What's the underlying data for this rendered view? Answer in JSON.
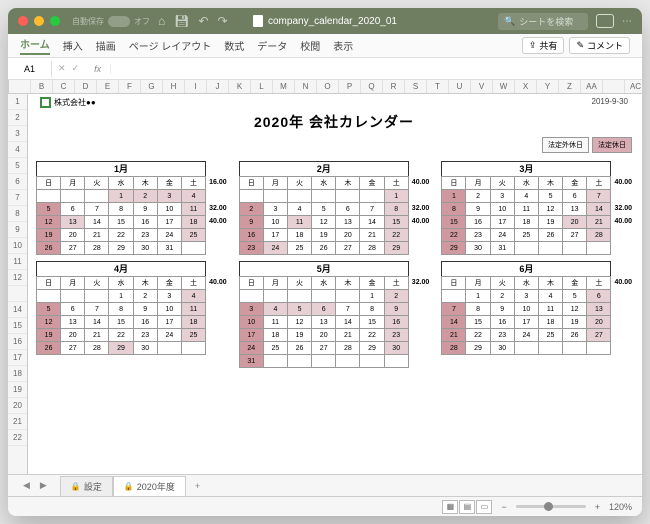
{
  "titlebar": {
    "doc": "company_calendar_2020_01",
    "search": "シートを検索",
    "autosave": "自動保存",
    "off": "オフ"
  },
  "menus": {
    "items": [
      "ホーム",
      "挿入",
      "描画",
      "ページ レイアウト",
      "数式",
      "データ",
      "校閲",
      "表示"
    ],
    "share": "共有",
    "comment": "コメント"
  },
  "fbar": {
    "cell": "A1",
    "fx": "fx"
  },
  "cols": [
    "",
    "B",
    "C",
    "D",
    "E",
    "F",
    "G",
    "H",
    "I",
    "J",
    "K",
    "L",
    "M",
    "N",
    "O",
    "P",
    "Q",
    "R",
    "S",
    "T",
    "U",
    "V",
    "W",
    "X",
    "Y",
    "Z",
    "AA",
    "",
    "AC"
  ],
  "rows": [
    "1",
    "2",
    "3",
    "4",
    "5",
    "6",
    "7",
    "8",
    "9",
    "10",
    "11",
    "12",
    "",
    "14",
    "15",
    "16",
    "17",
    "18",
    "19",
    "20",
    "21",
    "22"
  ],
  "sheet": {
    "company": "株式会社●●",
    "date": "2019-9-30",
    "title": "2020年 会社カレンダー",
    "legend1": "法定外休日",
    "legend2": "法定休日"
  },
  "dow": [
    "日",
    "月",
    "火",
    "水",
    "木",
    "金",
    "土"
  ],
  "months": [
    {
      "title": "1月",
      "side": [
        "16.00",
        "",
        "32.00",
        "40.00"
      ],
      "rows": [
        [
          "",
          "",
          "",
          {
            "t": "1",
            "c": "h1"
          },
          {
            "t": "2",
            "c": "h1"
          },
          {
            "t": "3",
            "c": "h1"
          },
          {
            "t": "4",
            "c": "h1"
          }
        ],
        [
          {
            "t": "5",
            "c": "h2"
          },
          "6",
          "7",
          "8",
          "9",
          "10",
          {
            "t": "11",
            "c": "h1"
          }
        ],
        [
          {
            "t": "12",
            "c": "h2"
          },
          {
            "t": "13",
            "c": "h1"
          },
          "14",
          "15",
          "16",
          "17",
          {
            "t": "18",
            "c": "h1"
          }
        ],
        [
          {
            "t": "19",
            "c": "h2"
          },
          "20",
          "21",
          "22",
          "23",
          "24",
          {
            "t": "25",
            "c": "h1"
          }
        ],
        [
          {
            "t": "26",
            "c": "h2"
          },
          "27",
          "28",
          "29",
          "30",
          "31",
          ""
        ]
      ]
    },
    {
      "title": "2月",
      "side": [
        "40.00",
        "",
        "32.00",
        "40.00"
      ],
      "rows": [
        [
          "",
          "",
          "",
          "",
          "",
          "",
          {
            "t": "1",
            "c": "h1"
          }
        ],
        [
          {
            "t": "2",
            "c": "h2"
          },
          "3",
          "4",
          "5",
          "6",
          "7",
          {
            "t": "8",
            "c": "h1"
          }
        ],
        [
          {
            "t": "9",
            "c": "h2"
          },
          "10",
          {
            "t": "11",
            "c": "h1"
          },
          "12",
          "13",
          "14",
          {
            "t": "15",
            "c": "h1"
          }
        ],
        [
          {
            "t": "16",
            "c": "h2"
          },
          "17",
          "18",
          "19",
          "20",
          "21",
          {
            "t": "22",
            "c": "h1"
          }
        ],
        [
          {
            "t": "23",
            "c": "h2"
          },
          {
            "t": "24",
            "c": "h1"
          },
          "25",
          "26",
          "27",
          "28",
          {
            "t": "29",
            "c": "h1"
          }
        ]
      ]
    },
    {
      "title": "3月",
      "side": [
        "40.00",
        "",
        "32.00",
        "40.00"
      ],
      "rows": [
        [
          {
            "t": "1",
            "c": "h2"
          },
          "2",
          "3",
          "4",
          "5",
          "6",
          {
            "t": "7",
            "c": "h1"
          }
        ],
        [
          {
            "t": "8",
            "c": "h2"
          },
          "9",
          "10",
          "11",
          "12",
          "13",
          {
            "t": "14",
            "c": "h1"
          }
        ],
        [
          {
            "t": "15",
            "c": "h2"
          },
          "16",
          "17",
          "18",
          "19",
          {
            "t": "20",
            "c": "h1"
          },
          {
            "t": "21",
            "c": "h1"
          }
        ],
        [
          {
            "t": "22",
            "c": "h2"
          },
          "23",
          "24",
          "25",
          "26",
          "27",
          {
            "t": "28",
            "c": "h1"
          }
        ],
        [
          {
            "t": "29",
            "c": "h2"
          },
          "30",
          "31",
          "",
          "",
          "",
          ""
        ]
      ]
    },
    {
      "title": "4月",
      "side": [
        "40.00",
        "",
        "",
        "",
        ""
      ],
      "rows": [
        [
          "",
          "",
          "",
          {
            "t": "1"
          },
          "2",
          "3",
          {
            "t": "4",
            "c": "h1"
          }
        ],
        [
          {
            "t": "5",
            "c": "h2"
          },
          "6",
          "7",
          "8",
          "9",
          "10",
          {
            "t": "11",
            "c": "h1"
          }
        ],
        [
          {
            "t": "12",
            "c": "h2"
          },
          "13",
          "14",
          "15",
          "16",
          "17",
          {
            "t": "18",
            "c": "h1"
          }
        ],
        [
          {
            "t": "19",
            "c": "h2"
          },
          "20",
          "21",
          "22",
          "23",
          "24",
          {
            "t": "25",
            "c": "h1"
          }
        ],
        [
          {
            "t": "26",
            "c": "h2"
          },
          "27",
          "28",
          {
            "t": "29",
            "c": "h1"
          },
          "30",
          "",
          ""
        ]
      ]
    },
    {
      "title": "5月",
      "side": [
        "32.00",
        "",
        "",
        "",
        ""
      ],
      "rows": [
        [
          "",
          "",
          "",
          "",
          "",
          {
            "t": "1"
          },
          {
            "t": "2",
            "c": "h1"
          }
        ],
        [
          {
            "t": "3",
            "c": "h2"
          },
          {
            "t": "4",
            "c": "h1"
          },
          {
            "t": "5",
            "c": "h1"
          },
          {
            "t": "6",
            "c": "h1"
          },
          "7",
          "8",
          {
            "t": "9",
            "c": "h1"
          }
        ],
        [
          {
            "t": "10",
            "c": "h2"
          },
          "11",
          "12",
          "13",
          "14",
          "15",
          {
            "t": "16",
            "c": "h1"
          }
        ],
        [
          {
            "t": "17",
            "c": "h2"
          },
          "18",
          "19",
          "20",
          "21",
          "22",
          {
            "t": "23",
            "c": "h1"
          }
        ],
        [
          {
            "t": "24",
            "c": "h2"
          },
          "25",
          "26",
          "27",
          "28",
          "29",
          {
            "t": "30",
            "c": "h1"
          }
        ],
        [
          {
            "t": "31",
            "c": "h2"
          },
          "",
          "",
          "",
          "",
          "",
          ""
        ]
      ]
    },
    {
      "title": "6月",
      "side": [
        "40.00",
        "",
        "",
        "",
        ""
      ],
      "rows": [
        [
          "",
          {
            "t": "1"
          },
          "2",
          "3",
          "4",
          "5",
          {
            "t": "6",
            "c": "h1"
          }
        ],
        [
          {
            "t": "7",
            "c": "h2"
          },
          "8",
          "9",
          "10",
          "11",
          "12",
          {
            "t": "13",
            "c": "h1"
          }
        ],
        [
          {
            "t": "14",
            "c": "h2"
          },
          "15",
          "16",
          "17",
          "18",
          "19",
          {
            "t": "20",
            "c": "h1"
          }
        ],
        [
          {
            "t": "21",
            "c": "h2"
          },
          "22",
          "23",
          "24",
          "25",
          "26",
          {
            "t": "27",
            "c": "h1"
          }
        ],
        [
          {
            "t": "28",
            "c": "h2"
          },
          "29",
          "30",
          "",
          "",
          "",
          ""
        ]
      ]
    }
  ],
  "tabs": {
    "t1": "設定",
    "t2": "2020年度"
  },
  "status": {
    "zoom": "120%"
  }
}
